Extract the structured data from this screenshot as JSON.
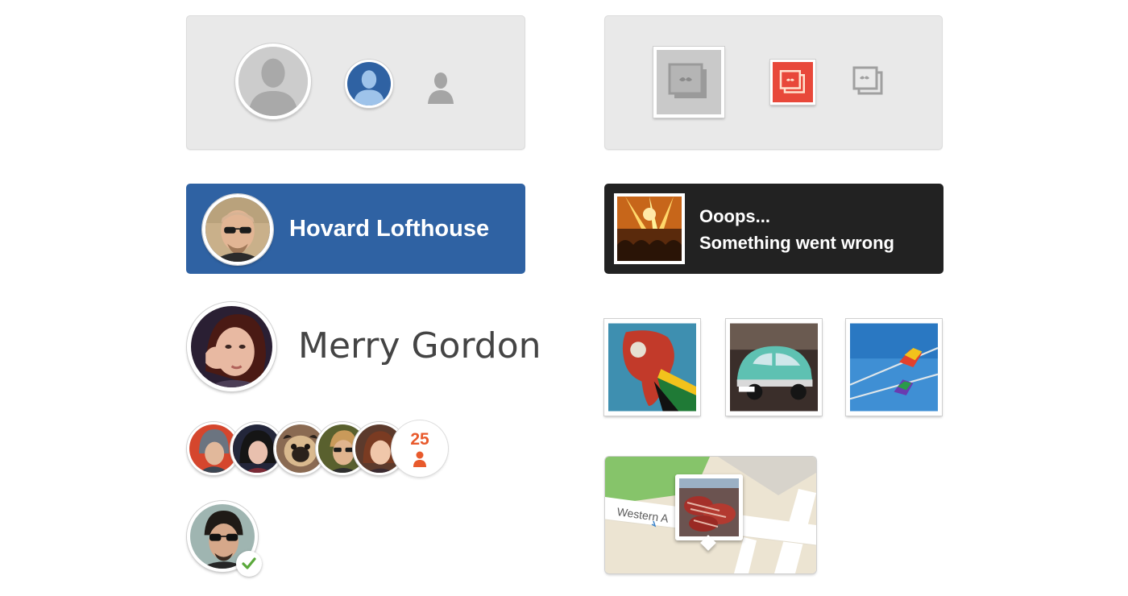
{
  "colors": {
    "card_blue": "#2f62a3",
    "notice_dark": "#222222",
    "accent_orange": "#e85a2c",
    "check_green": "#5aa83b"
  },
  "placeholders": {
    "user_icons": [
      "user-silhouette-large",
      "user-silhouette-medium-blue",
      "user-silhouette-small"
    ],
    "image_icons": [
      "image-placeholder-large",
      "image-placeholder-medium-red",
      "image-placeholder-small"
    ]
  },
  "profile_card": {
    "name": "Hovard Lofthouse"
  },
  "error_notice": {
    "line1": "Ooops...",
    "line2": "Something went wrong"
  },
  "profile": {
    "name": "Merry Gordon"
  },
  "avatar_group": {
    "count": "25"
  },
  "map": {
    "street_label": "Western A"
  }
}
